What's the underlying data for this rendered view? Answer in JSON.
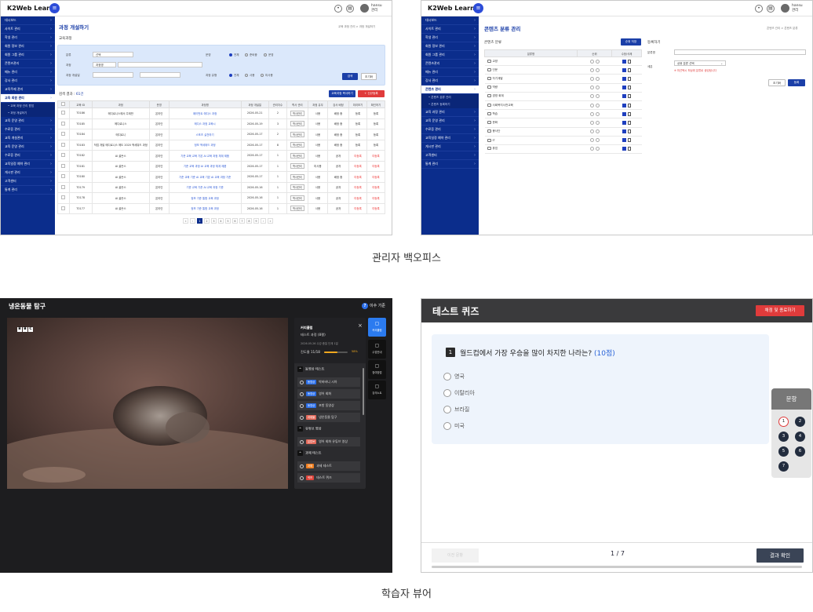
{
  "captions": {
    "admin": "관리자 백오피스",
    "learner": "학습자 뷰어"
  },
  "admin_common": {
    "logo": "K2Web Learn",
    "menu_icon_glyph": "≡",
    "user_name": "hansu",
    "user_role": "관리",
    "alert_glyph": "•",
    "print_glyph": "▤"
  },
  "course_admin": {
    "sidebar": [
      "대시보드",
      "사이트 관리",
      "학생 관리",
      "회원 정보 관리",
      "회원 그룹 관리",
      "콘텐츠관리",
      "메뉴 관리",
      "강사 관리",
      "교육주제 관리",
      "교육 회원 관리",
      "교육 운영 관리",
      "수료증 관리",
      "교육 개설관리",
      "교육 운영 관리",
      "수료증 관리",
      "교육일정 예약 관리",
      "게시판 관리",
      "고객센터",
      "통계 관리"
    ],
    "sidebar_active_index": 9,
    "sidebar_sub": [
      "• 교육 과정 관리 팝업",
      "• 과정 개설하기"
    ],
    "sidebar_sub_after": 9,
    "page_title": "과정 개설하기",
    "breadcrumb": "교육 과정 관리 > 과정 개설하기",
    "section": "교육과정",
    "filter": {
      "label_category": "분류",
      "category_value": "선택",
      "label_status": "운영",
      "status_options": [
        "전체",
        "준비중",
        "운영"
      ],
      "label_name": "과정",
      "name_select": "과정명",
      "label_period": "과정 개설일",
      "label_type": "과정 유형",
      "type_options": [
        "전체",
        "사용",
        "미사용"
      ],
      "search": "검색",
      "reset": "초기화"
    },
    "result_label": "검색 결과 : ",
    "result_count": "61건",
    "btn_copy": "교육과정 복사하기",
    "btn_create": "+ 신규등록",
    "columns": [
      "",
      "교육 ID",
      "과정",
      "운영",
      "과정명",
      "과정 개설일",
      "관리자수",
      "학사 관리",
      "과정 유무",
      "강사 배정",
      "미리보기",
      "확인하기"
    ],
    "rows": [
      [
        "T0186",
        "메디로니스에서 주제반",
        "온라인",
        "페이먼트 에디스 과정",
        "2026-05-21",
        "2",
        "학사관리",
        "사용",
        "배정 중",
        "등록",
        "등록"
      ],
      [
        "T0185",
        "메디로니스",
        "온라인",
        "메디스 과정 교육시",
        "2026-05-19",
        "3",
        "학사관리",
        "사용",
        "배정 중",
        "등록",
        "등록"
      ],
      [
        "T0184",
        "메디로니",
        "온라인",
        "스포츠 실천하기",
        "2026-05-17",
        "2",
        "학사관리",
        "사용",
        "배정 중",
        "등록",
        "등록"
      ],
      [
        "T0183",
        "작업 개발 메디로니스 에도 2020 액세워드 과정",
        "온라인",
        "정보 액세위드 과정",
        "2026-05-17",
        "8",
        "학사관리",
        "사용",
        "배정 중",
        "등록",
        "등록"
      ],
      [
        "T0182",
        "AI 골든스",
        "온라인",
        "기준 교육 교육 기본 AI 교육 과정 체계 제품",
        "2026-05-17",
        "1",
        "학사관리",
        "사용",
        "공개",
        "미등록",
        "미등록"
      ],
      [
        "T0181",
        "AI 골든스",
        "온라인",
        "기준 교육 과정 AI 교육 과정 체계 제품",
        "2026-05-17",
        "1",
        "학사관리",
        "미사용",
        "공개",
        "미등록",
        "미등록"
      ],
      [
        "T0180",
        "AI 골든스",
        "온라인",
        "기준 교육 기준 AI 교육 기본 AI 교육 과정 기준",
        "2026-05-17",
        "1",
        "학사관리",
        "사용",
        "배정 중",
        "미등록",
        "미등록"
      ],
      [
        "T0179",
        "AI 골든스",
        "온라인",
        "기준 교육 기준 AI 교육 과정 기준",
        "2026-05-16",
        "1",
        "학사관리",
        "사용",
        "공개",
        "미등록",
        "미등록"
      ],
      [
        "T0178",
        "AI 골든스",
        "온라인",
        "정보 기준 통합 교육 과정",
        "2026-05-16",
        "1",
        "학사관리",
        "사용",
        "공개",
        "미등록",
        "미등록"
      ],
      [
        "T0177",
        "AI 골든스",
        "온라인",
        "정보 기준 통합 교육 과정",
        "2026-05-16",
        "1",
        "학사관리",
        "사용",
        "공개",
        "미등록",
        "미등록"
      ]
    ],
    "pages": [
      "«",
      "‹",
      "1",
      "2",
      "3",
      "4",
      "5",
      "6",
      "7",
      "8",
      "9",
      "›",
      "»"
    ]
  },
  "content_admin": {
    "sidebar": [
      "대시보드",
      "사이트 관리",
      "학생 관리",
      "회원 정보 관리",
      "회원 그룹 관리",
      "콘텐츠관리",
      "메뉴 관리",
      "강사 관리",
      "콘텐츠 관리",
      "교육 과정 관리",
      "교육 운영 관리",
      "수료증 관리",
      "교육일정 예약 관리",
      "게시판 관리",
      "고객센터",
      "통계 관리"
    ],
    "sidebar_active_index": 8,
    "sidebar_sub": [
      "• 콘텐츠 분류 관리",
      "• 콘텐츠 등록하기"
    ],
    "page_title": "콘텐츠 분류 관리",
    "breadcrumb": "콘텐츠 관리 > 콘텐츠 분류",
    "list_title": "콘텐츠 분류",
    "btn_order": "순위 저장",
    "columns": [
      "분류명",
      "순위",
      "수정/삭제"
    ],
    "categories": [
      "교양",
      "인문",
      "자기계발",
      "역량",
      "경영 회계",
      "사회복지사전교육",
      "학습",
      "문화",
      "봉사단",
      "IT",
      "휴업"
    ],
    "form_title": "등록하기",
    "label_name": "분류명",
    "label_parent": "세분",
    "parent_select": "상위 분류 선택",
    "parent_note": "※ 미선택시 최상위 분류로 생성됩니다",
    "btn_reset": "초기화",
    "btn_save": "등록"
  },
  "video_viewer": {
    "title": "냉온동물 탐구",
    "help": "이수 기준",
    "help_glyph": "?",
    "bbc": [
      "B",
      "B",
      "C"
    ],
    "panel_title": "커리큘럼",
    "course_name": "테스트 과정 (8평)",
    "course_period": "2026.05.26 수강 중일 단계 1일",
    "progress_label": "진도율 11/18",
    "progress_value": 0.58,
    "progress_text": "58%",
    "close_glyph": "×",
    "sections": [
      {
        "name": "동영상 테스트",
        "items": [
          [
            "동영상",
            "박바바니 시아",
            "#2b6ee8"
          ],
          [
            "동영상",
            "영어 회화",
            "#2b6ee8"
          ],
          [
            "동영상",
            "포항 동영상",
            "#2b6ee8"
          ],
          [
            "과제물",
            "냉온동물 탐구",
            "#e46a5b"
          ]
        ]
      },
      {
        "name": "유튜브 영상",
        "items": [
          [
            "유튜브",
            "영어 회화 유튜브 영상",
            "#e46a5b"
          ]
        ]
      },
      {
        "name": "과제 테스트",
        "items": [
          [
            "과제",
            "과제 테스트",
            "#f07e1e"
          ],
          [
            "퀴즈",
            "테스트 퀴즈",
            "#e0443a"
          ]
        ]
      }
    ],
    "tabs": [
      "커리큘럼",
      "수업안내",
      "참여방법",
      "강의노트"
    ]
  },
  "quiz_viewer": {
    "title": "테스트 퀴즈",
    "submit": "채점 및 종료하기",
    "q_number": "1",
    "q_text": "월드컵에서 가장 우승을 많이 차지한 나라는?",
    "q_points": "(10점)",
    "options": [
      "영국",
      "이탈리아",
      "브라질",
      "미국"
    ],
    "nav_title": "문항",
    "numbers": [
      "1",
      "2",
      "3",
      "4",
      "5",
      "6",
      "7"
    ],
    "prev": "이전 문항",
    "page": "1 / 7",
    "next": "결과 확인"
  }
}
